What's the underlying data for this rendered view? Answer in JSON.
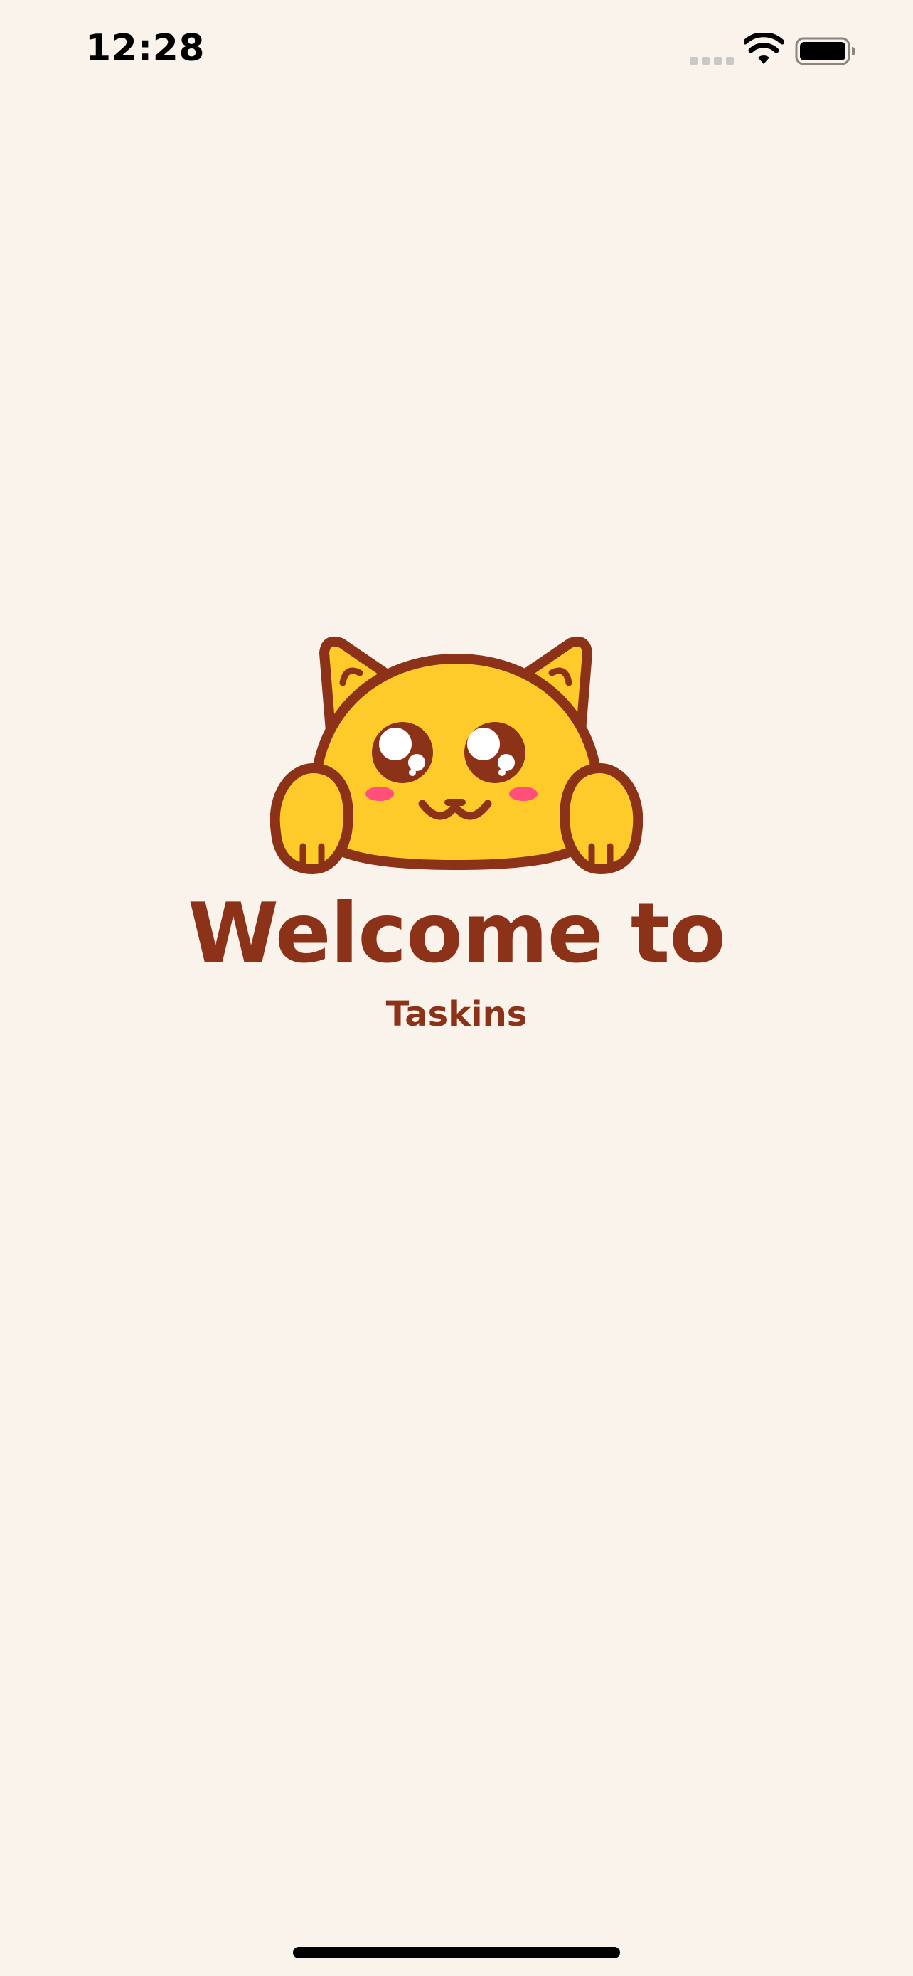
{
  "status_bar": {
    "time": "12:28",
    "icons": [
      "cellular-signal-icon",
      "wifi-icon",
      "battery-icon"
    ]
  },
  "welcome": {
    "title": "Welcome to",
    "app_name": "Taskins",
    "mascot": "cat-mascot-icon"
  },
  "colors": {
    "background": "#FAF3EC",
    "brand_text": "#8B3219",
    "mascot_body": "#FFCB2B",
    "mascot_outline": "#8B3219",
    "mascot_cheeks": "#FF4F7A"
  }
}
